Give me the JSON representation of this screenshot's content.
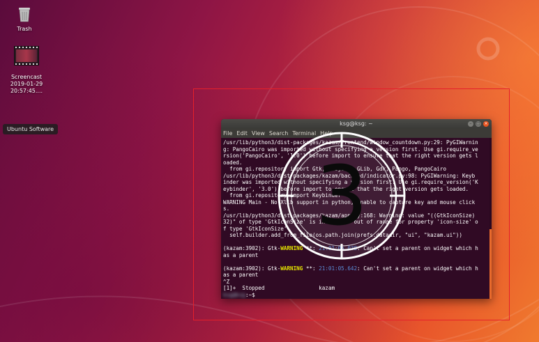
{
  "desktop": {
    "icons": [
      {
        "label": "Trash"
      },
      {
        "label": "Screencast\n2019-01-29\n20:57:45...."
      }
    ],
    "tooltip": "Ubuntu Software"
  },
  "terminal": {
    "title": "ksg@ksg: ~",
    "menu": [
      "File",
      "Edit",
      "View",
      "Search",
      "Terminal",
      "Help"
    ],
    "lines": [
      "/usr/lib/python3/dist-packages/kazam/frontend/window_countdown.py:29: PyGIWarnin",
      "g: PangoCairo was imported without specifying a version first. Use gi.require_ve",
      "rsion('PangoCairo', '1.0') before import to ensure that the right version gets l",
      "oaded.",
      "  from gi.repository import Gtk, GObject, GLib, Gdk, Pango, PangoCairo",
      "/usr/lib/python3/dist-packages/kazam/backend/indicator.py:98: PyGIWarning: Keyb",
      "inder was imported without specifying a version first. Use gi.require_version('K",
      "eybinder', '3.0') before import to ensure that the right version gets loaded.",
      "  from gi.repository import Keybinder",
      "WARNING Main - No Xlib support in python, unable to capture key and mouse click",
      "s.",
      "/usr/lib/python3/dist-packages/kazam/app.py:168: Warning: value \"((GtkIconSize)",
      "32)\" of type 'GtkIconSize' is invalid or out of range for property 'icon-size' o",
      "f type 'GtkIconSize'",
      "  self.builder.add_from_file(os.path.join(prefs.datadir, \"ui\", \"kazam.ui\"))",
      ""
    ],
    "warn1": {
      "prefix": "(kazam:3902): Gtk-",
      "level": "WARNING",
      "mid": " **: ",
      "time": "21:01:05.038",
      "msg": ": Can't set a parent on widget which h",
      "cont": "as a parent"
    },
    "warn2": {
      "prefix": "(kazam:3902): Gtk-",
      "level": "WARNING",
      "mid": " **: ",
      "time": "21:01:05.642",
      "msg": ": Can't set a parent on widget which h",
      "cont": "as a parent"
    },
    "ctrlz": "^Z",
    "stopped": "[1]+  Stopped                 kazam",
    "prompt_user": "ksg@ksg",
    "prompt_rest": ":~$"
  },
  "countdown": {
    "number": "3"
  }
}
